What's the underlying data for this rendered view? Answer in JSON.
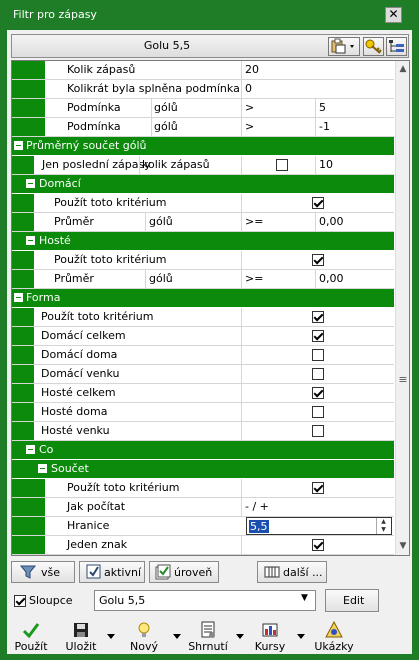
{
  "window": {
    "title": "Filtr pro zápasy",
    "close_glyph": "✕"
  },
  "header": {
    "title": "Golu 5,5",
    "icons": [
      "clipboard-dropdown-icon",
      "key-icon",
      "hierarchy-icon"
    ]
  },
  "rows": {
    "r1": {
      "label": "Kolik zápasů",
      "value": "20"
    },
    "r2": {
      "label": "Kolikrát byla splněna podmínka",
      "value": "0"
    },
    "r3": {
      "label": "Podmínka",
      "sub": "gólů",
      "op": ">",
      "value": "5"
    },
    "r4": {
      "label": "Podmínka",
      "sub": "gólů",
      "op": ">",
      "value": "-1"
    },
    "s1": {
      "label": "Průměrný součet gólů"
    },
    "r5": {
      "label": "Jen poslední zápasy",
      "sub": "kolik zápasů",
      "value": "10",
      "checked": false
    },
    "s2": {
      "label": "Domácí"
    },
    "r6": {
      "label": "Použít toto kritérium",
      "checked": true
    },
    "r7": {
      "label": "Průměr",
      "sub": "gólů",
      "op": ">=",
      "value": "0,00"
    },
    "s3": {
      "label": "Hosté"
    },
    "r8": {
      "label": "Použít toto kritérium",
      "checked": true
    },
    "r9": {
      "label": "Průměr",
      "sub": "gólů",
      "op": ">=",
      "value": "0,00"
    },
    "s4": {
      "label": "Forma"
    },
    "r10": {
      "label": "Použít toto kritérium",
      "checked": true
    },
    "r11": {
      "label": "Domácí celkem",
      "checked": true
    },
    "r12": {
      "label": "Domácí doma",
      "checked": false
    },
    "r13": {
      "label": "Domácí venku",
      "checked": false
    },
    "r14": {
      "label": "Hosté celkem",
      "checked": true
    },
    "r15": {
      "label": "Hosté doma",
      "checked": false
    },
    "r16": {
      "label": "Hosté venku",
      "checked": false
    },
    "s5": {
      "label": "Co"
    },
    "s6": {
      "label": "Součet"
    },
    "r17": {
      "label": "Použít toto kritérium",
      "checked": true
    },
    "r18": {
      "label": "Jak počítat",
      "value": "- / +"
    },
    "r19": {
      "label": "Hranice",
      "value": "5,5"
    },
    "r20": {
      "label": "Jeden znak",
      "checked": true
    }
  },
  "buttons": {
    "all": "vše",
    "active": "aktivní",
    "level": "úroveň",
    "more": "další ..."
  },
  "columns": {
    "label": "Sloupce",
    "checked": true,
    "selected": "Golu 5,5",
    "edit": "Edit"
  },
  "toolbar": {
    "apply": "Použít",
    "save": "Uložit",
    "new": "Nový",
    "summary": "Shrnutí",
    "odds": "Kursy",
    "examples": "Ukázky"
  },
  "colors": {
    "accent": "#1e7d26",
    "section": "#0b8a0b",
    "selection": "#1a4fb0"
  }
}
